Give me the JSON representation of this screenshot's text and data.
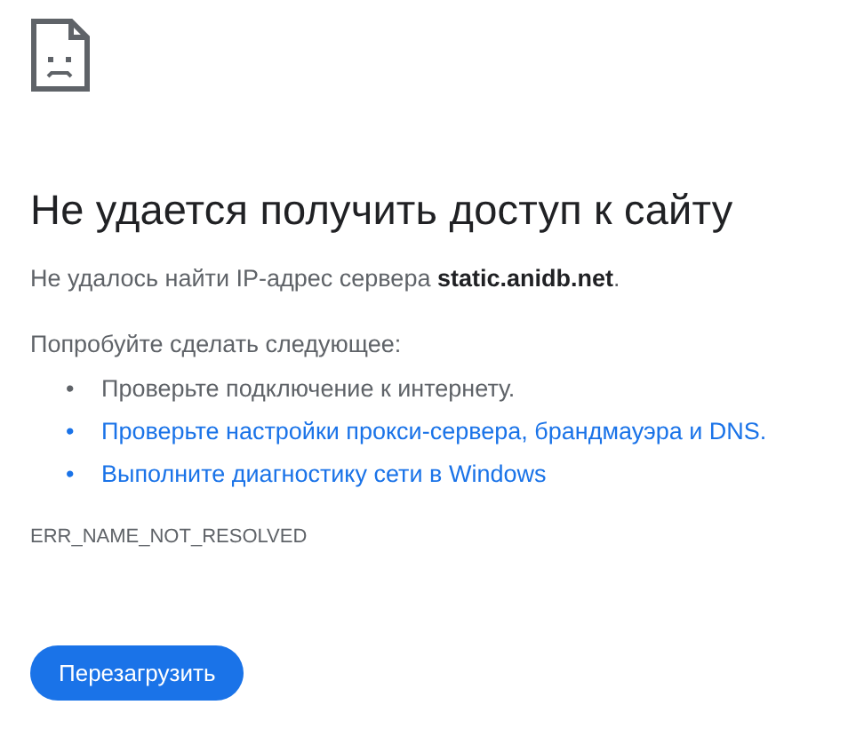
{
  "heading": "Не удается получить доступ к сайту",
  "summary": "Не удалось найти IP-адрес сервера **static.anidb.net**.",
  "suggestions_title": "Попробуйте сделать следующее:",
  "suggestions": [
    {
      "bullet": "•",
      "text": "Проверьте подключение к интернету.",
      "kind": "text"
    },
    {
      "bullet": "•",
      "text": "Проверьте настройки прокси-сервера, брандмауэра и DNS.",
      "kind": "link"
    },
    {
      "bullet": "•",
      "text": "Выполните диагностику сети в Windows",
      "kind": "link"
    }
  ],
  "error_code": "ERR_NAME_NOT_RESOLVED",
  "button": "Перезагрузить"
}
